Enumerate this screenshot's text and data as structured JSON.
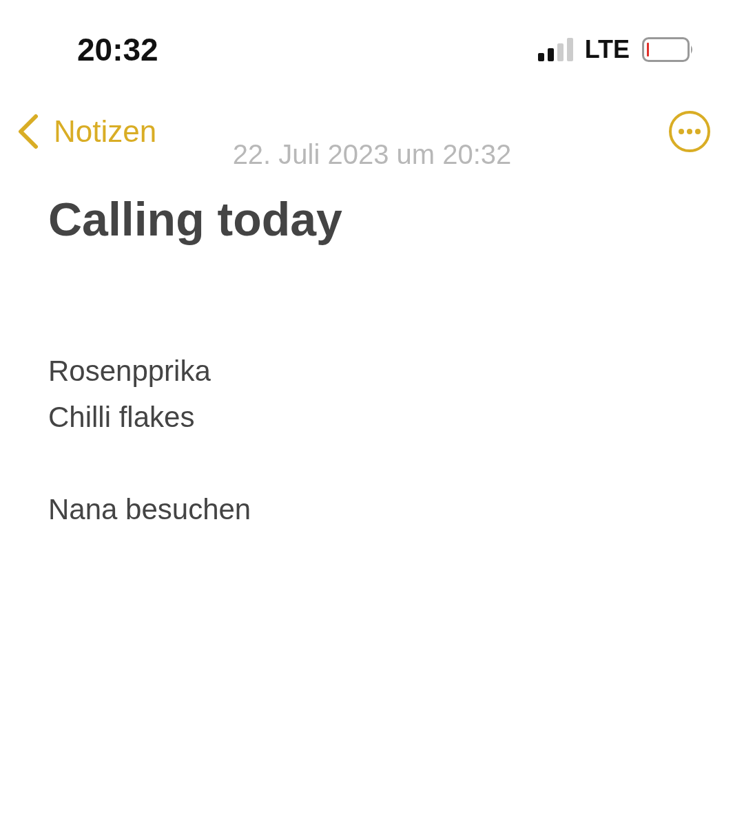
{
  "status_bar": {
    "time": "20:32",
    "network": "LTE"
  },
  "nav": {
    "back_label": "Notizen"
  },
  "note": {
    "date": "22. Juli 2023 um 20:32",
    "title": "Calling today",
    "paragraphs": [
      [
        "Rosenpprika",
        "Chilli flakes"
      ],
      [
        "Nana besuchen"
      ]
    ]
  }
}
